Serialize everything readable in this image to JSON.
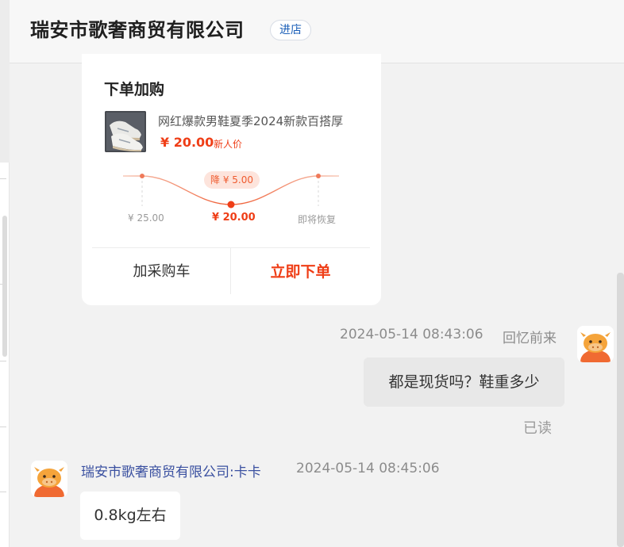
{
  "header": {
    "shop_name": "瑞安市歌奢商贸有限公司",
    "enter_shop_label": "进店"
  },
  "order_card": {
    "title": "下单加购",
    "product_name": "网红爆款男鞋夏季2024新款百搭厚",
    "price": "¥ 20.00",
    "price_tag": "新人价",
    "price_drop_badge": "降 ¥ 5.00",
    "trend_labels": {
      "before": "¥ 25.00",
      "now": "¥ 20.00",
      "after": "即将恢复"
    },
    "add_to_cart_label": "加采购车",
    "order_now_label": "立即下单"
  },
  "messages": [
    {
      "direction": "outgoing",
      "timestamp": "2024-05-14 08:43:06",
      "sender": "回忆前来",
      "text": "都是现货吗？鞋重多少",
      "status": "已读"
    },
    {
      "direction": "incoming",
      "sender": "瑞安市歌奢商贸有限公司:卡卡",
      "timestamp": "2024-05-14 08:45:06",
      "text": "0.8kg左右"
    }
  ],
  "colors": {
    "accent": "#ef3e17",
    "link_blue": "#1b5fb8",
    "sender_blue": "#3a50a0",
    "bubble_out": "#e8e8e8",
    "avatar_orange": "#f06a32"
  },
  "icons": [
    "product-thumbnail",
    "cow-avatar-icon"
  ]
}
